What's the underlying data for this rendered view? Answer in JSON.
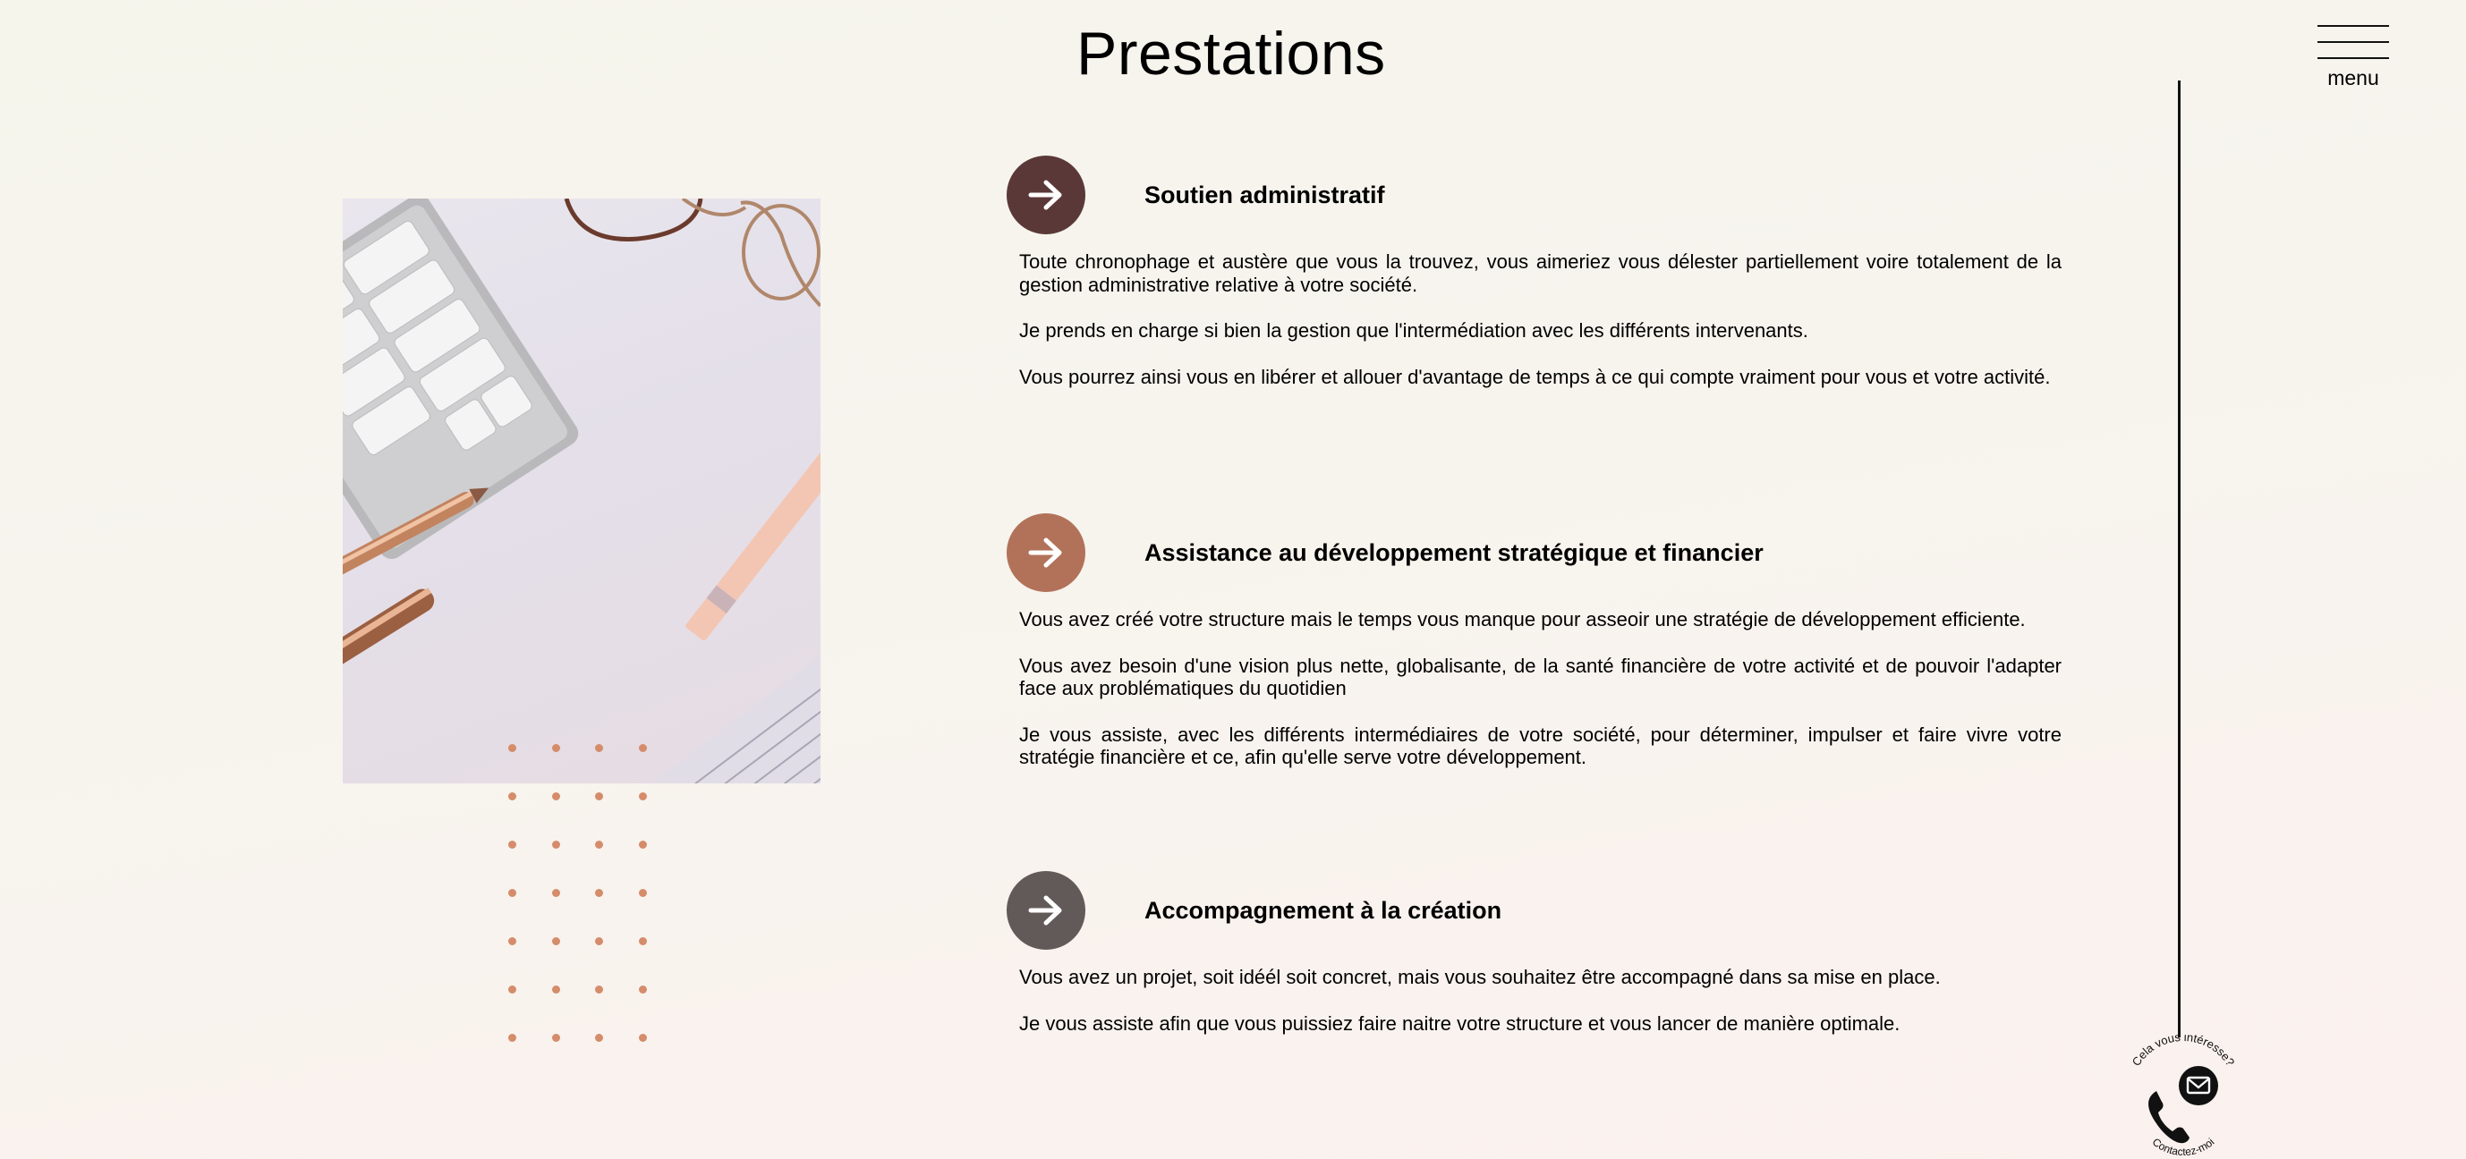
{
  "page": {
    "title": "Prestations"
  },
  "menu": {
    "label": "menu"
  },
  "services": [
    {
      "title": "Soutien administratif",
      "icon": "arrow-right-icon",
      "icon_color": "#5b3838",
      "paragraphs": [
        "Toute chronophage et austère que vous la trouvez, vous aimeriez vous délester partiellement voire totalement de la gestion administrative relative à votre société.",
        "Je prends en charge si bien la gestion que l'intermédiation avec les différents intervenants.",
        "Vous pourrez ainsi vous en libérer et allouer d'avantage de temps à ce qui compte vraiment pour vous et votre activité."
      ]
    },
    {
      "title": "Assistance au développement stratégique et financier",
      "icon": "arrow-right-icon",
      "icon_color": "#b2725a",
      "paragraphs": [
        "Vous avez créé votre structure mais le temps vous manque pour asseoir une stratégie de développement efficiente.",
        "Vous avez besoin d'une vision plus nette, globalisante, de la santé financière de votre activité et de pouvoir l'adapter face aux problématiques du quotidien",
        "Je vous assiste, avec les différents intermédiaires de votre société, pour déterminer, impulser et faire vivre votre stratégie financière et ce, afin qu'elle serve votre développement."
      ]
    },
    {
      "title": "Accompagnement à la création",
      "icon": "arrow-right-icon",
      "icon_color": "#625a58",
      "paragraphs": [
        "Vous avez un projet, soit idéél soit concret, mais vous souhaitez être accompagné dans sa mise en place.",
        "Je vous assiste afin que vous puissiez faire naitre votre structure et vous lancer de manière optimale."
      ]
    }
  ],
  "contact": {
    "top_text": "Cela vous intéresse?",
    "bottom_text": "Contactez-moi",
    "icons": [
      "phone-icon",
      "envelope-icon"
    ]
  },
  "colors": {
    "dots": "#d58c6a"
  }
}
